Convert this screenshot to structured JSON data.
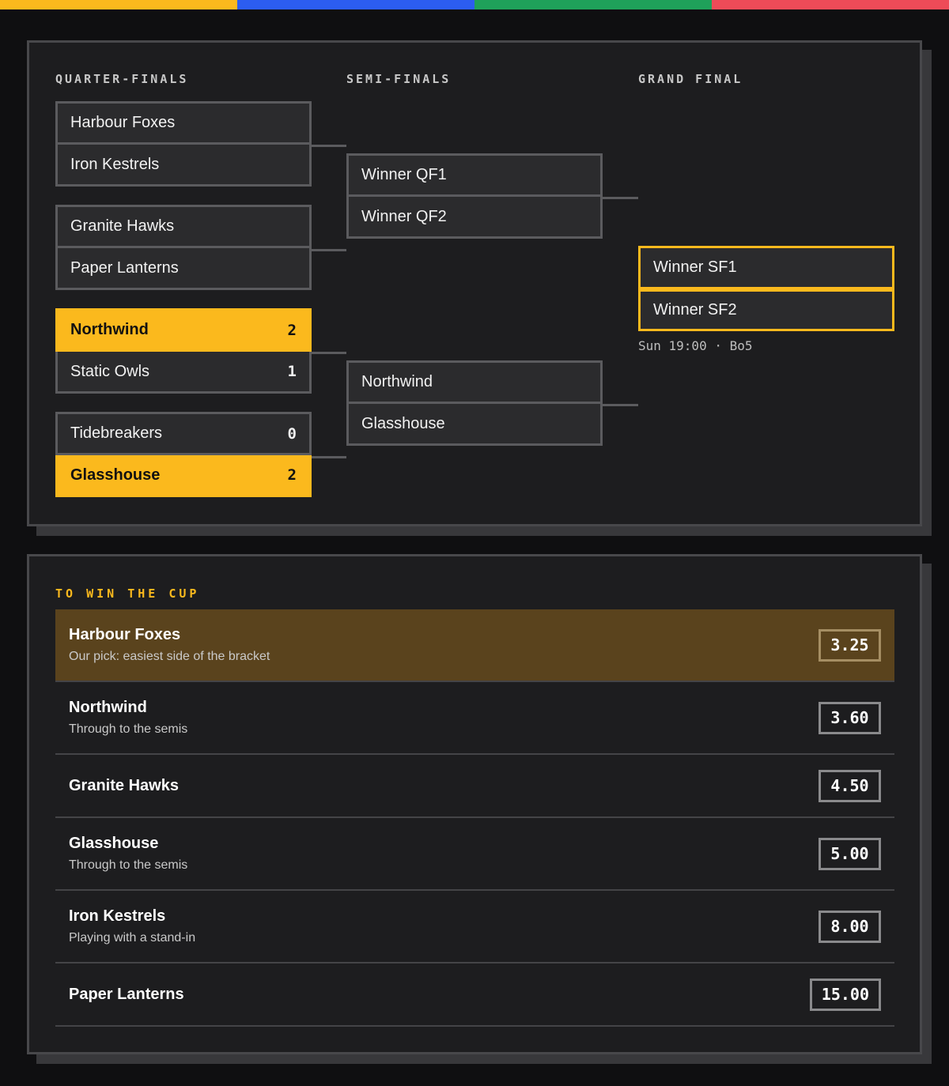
{
  "colors": {
    "accent": "#fbb91d",
    "stripe": [
      "#fbb91d",
      "#2c5df0",
      "#1fa15a",
      "#ee4b58"
    ],
    "panel": "#1d1d1f",
    "pick_row": "#5a431d"
  },
  "bracket": {
    "rounds": {
      "quarter": "QUARTER-FINALS",
      "semi": "SEMI-FINALS",
      "final": "GRAND FINAL"
    },
    "qf": [
      {
        "a": {
          "name": "Harbour Foxes",
          "score": ""
        },
        "b": {
          "name": "Iron Kestrels",
          "score": ""
        }
      },
      {
        "a": {
          "name": "Granite Hawks",
          "score": ""
        },
        "b": {
          "name": "Paper Lanterns",
          "score": ""
        }
      },
      {
        "a": {
          "name": "Northwind",
          "score": "2"
        },
        "b": {
          "name": "Static Owls",
          "score": "1"
        }
      },
      {
        "a": {
          "name": "Tidebreakers",
          "score": "0"
        },
        "b": {
          "name": "Glasshouse",
          "score": "2"
        }
      }
    ],
    "sf": [
      {
        "a": {
          "name": "Winner QF1"
        },
        "b": {
          "name": "Winner QF2"
        }
      },
      {
        "a": {
          "name": "Northwind"
        },
        "b": {
          "name": "Glasshouse"
        }
      }
    ],
    "final": {
      "a": {
        "name": "Winner SF1"
      },
      "b": {
        "name": "Winner SF2"
      },
      "meta": "Sun 19:00 · Bo5"
    }
  },
  "odds": {
    "title": "TO WIN THE CUP",
    "rows": [
      {
        "team": "Harbour Foxes",
        "note": "Our pick: easiest side of the bracket",
        "price": "3.25"
      },
      {
        "team": "Northwind",
        "note": "Through to the semis",
        "price": "3.60"
      },
      {
        "team": "Granite Hawks",
        "note": "",
        "price": "4.50"
      },
      {
        "team": "Glasshouse",
        "note": "Through to the semis",
        "price": "5.00"
      },
      {
        "team": "Iron Kestrels",
        "note": "Playing with a stand-in",
        "price": "8.00"
      },
      {
        "team": "Paper Lanterns",
        "note": "",
        "price": "15.00"
      }
    ]
  }
}
